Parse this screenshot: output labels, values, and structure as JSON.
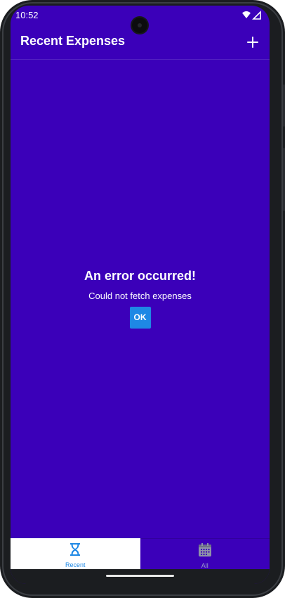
{
  "status_bar": {
    "time": "10:52",
    "icons": [
      "wifi-icon",
      "signal-icon"
    ]
  },
  "header": {
    "title": "Recent Expenses",
    "add_icon": "plus-icon"
  },
  "error": {
    "title": "An error occurred!",
    "message": "Could not fetch expenses",
    "button_label": "OK"
  },
  "tabs": [
    {
      "label": "Recent",
      "icon": "hourglass-icon",
      "selected": true
    },
    {
      "label": "All",
      "icon": "calendar-icon",
      "selected": false
    }
  ],
  "colors": {
    "primary": "#3b00b9",
    "accent": "#1e88e5",
    "tab_active_bg": "#ffffff",
    "tab_inactive_text": "#9aa0c8"
  }
}
